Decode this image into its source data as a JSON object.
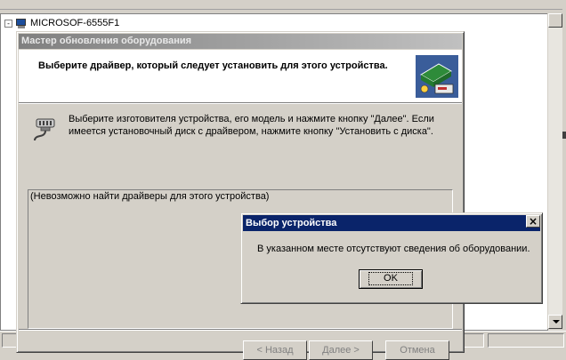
{
  "background_app": {
    "tree_root_expander": "-",
    "tree_root_label": "MICROSOF-6555F1",
    "toolbar_icons": [
      "back-icon",
      "forward-icon",
      "up-icon",
      "properties-icon",
      "print-icon",
      "help-icon",
      "view-icon",
      "scan-icon",
      "update-icon",
      "disable-icon",
      "uninstall-icon"
    ]
  },
  "wizard": {
    "title": "Мастер обновления оборудования",
    "heading": "Выберите драйвер, который следует установить для этого устройства.",
    "instructions": "Выберите изготовителя устройства, его модель и нажмите кнопку \"Далее\". Если имеется установочный диск с  драйвером, нажмите кнопку \"Установить с диска\".",
    "driver_list_item": "(Невозможно найти драйверы для этого устройства)",
    "buttons": {
      "back": "< Назад",
      "next": "Далее >",
      "cancel": "Отмена"
    }
  },
  "dialog": {
    "title": "Выбор устройства",
    "close_glyph": "×",
    "message": "В указанном месте отсутствуют сведения об оборудовании.",
    "ok_label": "OK"
  },
  "colors": {
    "dialog_titlebar": "#0a246a",
    "inactive_titlebar": "#808080",
    "window_face": "#d4d0c8"
  }
}
